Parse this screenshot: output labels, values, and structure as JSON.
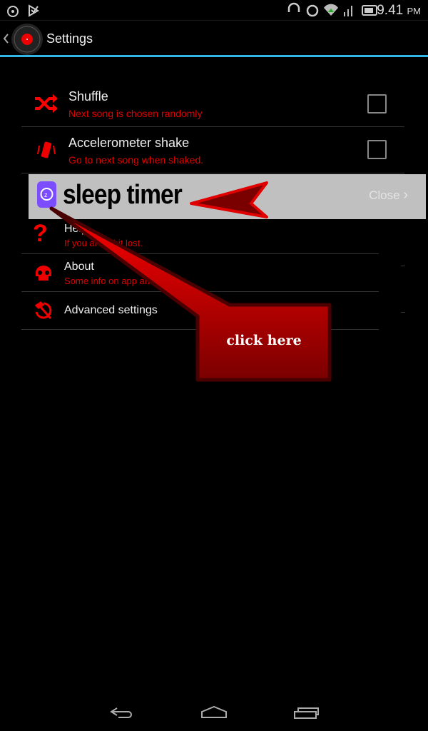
{
  "status_bar": {
    "time": "9.41",
    "ampm": "PM",
    "icons": [
      "music-note-icon",
      "download-check-icon",
      "headphones-icon",
      "alarm-icon",
      "wifi-icon",
      "signal-icon",
      "battery-icon"
    ]
  },
  "action_bar": {
    "title": "Settings",
    "app_icon": "vinyl-record-icon"
  },
  "settings": [
    {
      "title": "Shuffle",
      "subtitle": "Next song is chosen randomly",
      "icon": "shuffle-icon",
      "checked": false
    },
    {
      "title": "Accelerometer shake",
      "subtitle": "Go to next song when shaked.",
      "icon": "phone-vibrate-icon",
      "checked": false
    },
    {
      "title": "Help",
      "subtitle": "If you are a bit lost.",
      "icon": "question-icon"
    },
    {
      "title": "About",
      "subtitle": "Some info on app and author.",
      "icon": "skull-icon"
    },
    {
      "title": "Advanced settings",
      "icon": "hammer-sickle-icon"
    }
  ],
  "banner": {
    "label": "sleep timer",
    "close": "Close",
    "icon": "sleep-timer-icon"
  },
  "callout": {
    "label": "click here"
  },
  "colors": {
    "accent": "#33b5e5",
    "subtitle": "#e00000",
    "banner": "#c0c0c0",
    "callout": "#ff0000"
  }
}
